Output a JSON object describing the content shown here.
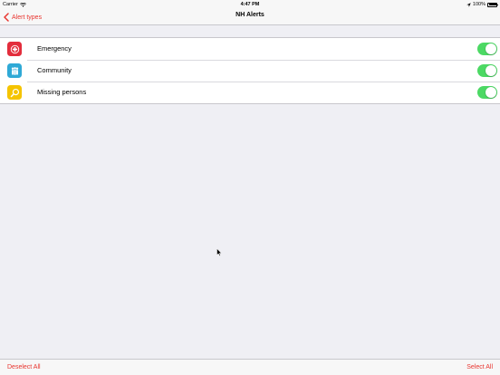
{
  "status_bar": {
    "carrier": "Carrier",
    "time": "4:47 PM",
    "battery": "100%"
  },
  "nav": {
    "back_label": "Alert types",
    "title": "NH Alerts"
  },
  "alerts": [
    {
      "label": "Emergency",
      "icon": "emergency-cross-icon",
      "icon_color": "#e32d3c",
      "enabled": true
    },
    {
      "label": "Community",
      "icon": "community-people-icon",
      "icon_color": "#2fa9d6",
      "enabled": true
    },
    {
      "label": "Missing persons",
      "icon": "magnifier-icon",
      "icon_color": "#f5c400",
      "enabled": true
    }
  ],
  "toolbar": {
    "deselect_all": "Deselect All",
    "select_all": "Select All"
  },
  "colors": {
    "accent": "#e8352f",
    "toggle_on": "#4cd964",
    "background": "#efeff4"
  }
}
